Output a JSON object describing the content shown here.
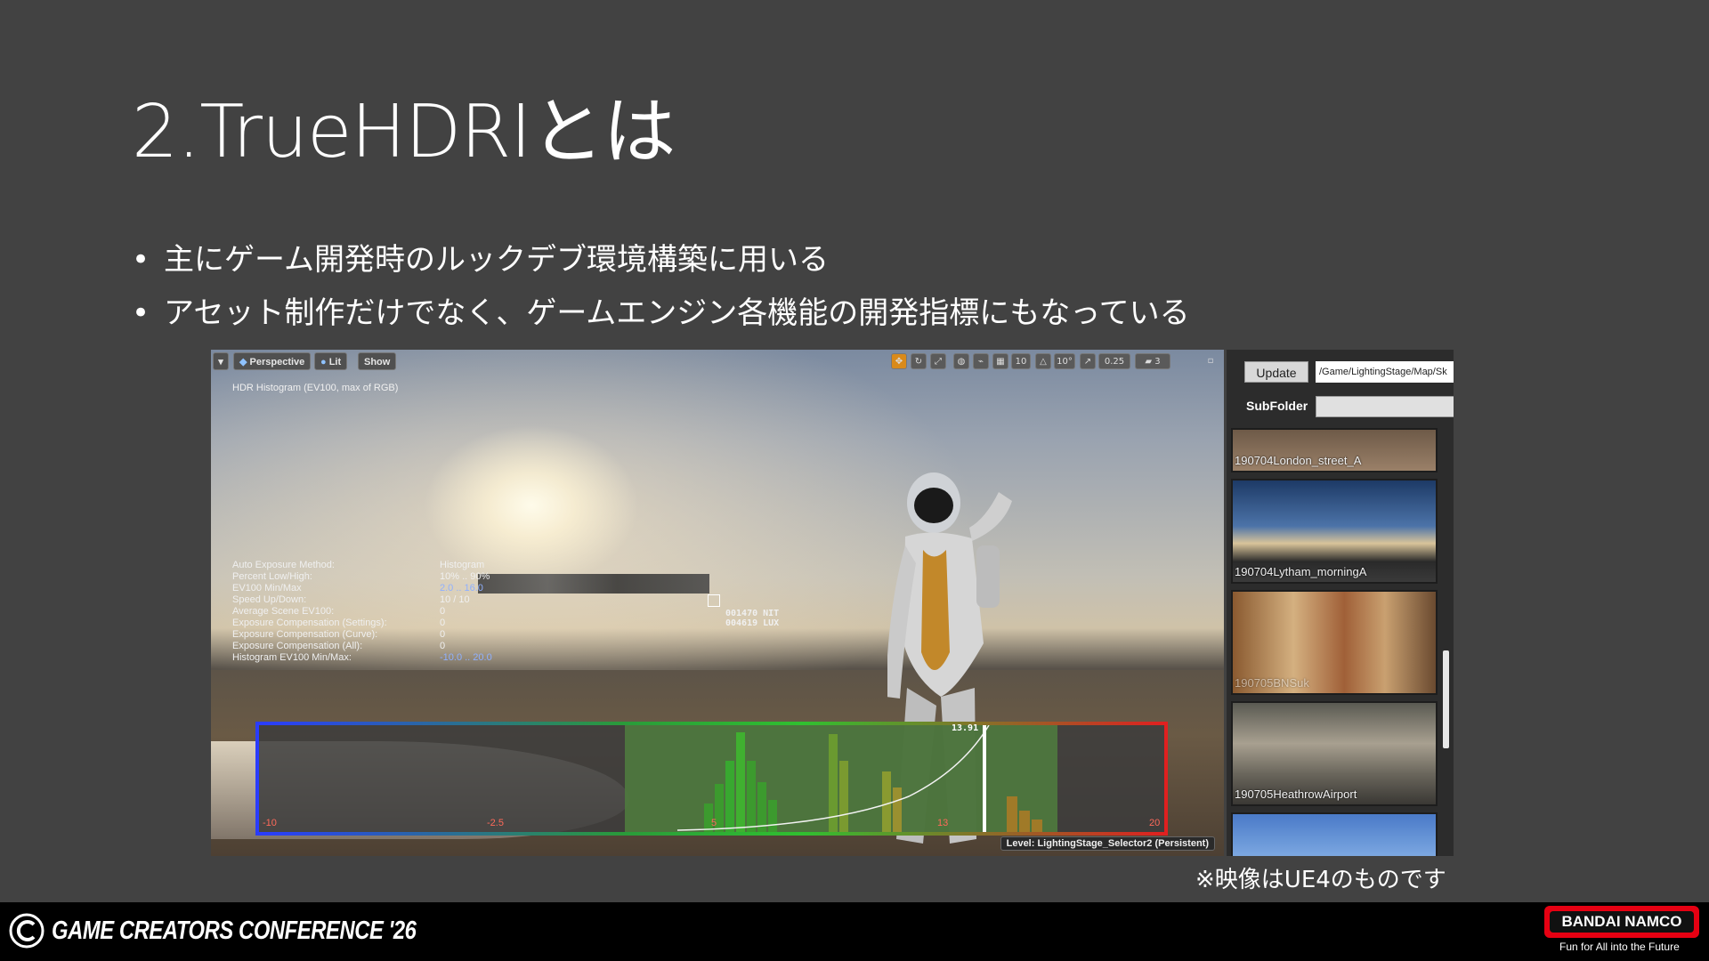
{
  "slide": {
    "title": "2.TrueHDRIとは",
    "bullets": [
      "主にゲーム開発時のルックデブ環境構築に用いる",
      "アセット制作だけでなく、ゲームエンジン各機能の開発指標にもなっている"
    ],
    "note": "※映像はUE4のものです"
  },
  "viewport": {
    "toolbar": {
      "dropdown": "▾",
      "perspective": "Perspective",
      "lit": "Lit",
      "show": "Show",
      "grid_snap": "10",
      "angle_snap": "10°",
      "scale_snap": "0.25",
      "camera_speed": "3"
    },
    "histogram_title": "HDR Histogram (EV100, max of RGB)",
    "stats": [
      {
        "label": "Auto Exposure Method:",
        "value": "Histogram",
        "color": "#f0f0f0"
      },
      {
        "label": "Percent Low/High:",
        "value": "10% .. 90%",
        "color": "#f0f0f0"
      },
      {
        "label": "EV100 Min/Max",
        "value": "2.0 .. 16.0",
        "color": "#8fb0ff"
      },
      {
        "label": "Speed Up/Down:",
        "value": "10 / 10",
        "color": "#f0f0f0"
      },
      {
        "label": "Average Scene EV100:",
        "value": "0",
        "color": "#f0f0f0"
      },
      {
        "label": "Exposure Compensation (Settings):",
        "value": "0",
        "color": "#f0f0f0"
      },
      {
        "label": "Exposure Compensation (Curve):",
        "value": "0",
        "color": "#f0f0f0"
      },
      {
        "label": "Exposure Compensation (All):",
        "value": "0",
        "color": "#f0f0f0"
      },
      {
        "label": "Histogram EV100 Min/Max:",
        "value": "-10.0 .. 20.0",
        "color": "#8fb0ff"
      }
    ],
    "probe": {
      "nit": "001470 NIT",
      "lux": "004619 LUX"
    },
    "histogram": {
      "axis_labels": [
        "-10",
        "-2.5",
        "5",
        "13",
        "20"
      ],
      "current_value": "13.91"
    },
    "level_label": "Level:  LightingStage_Selector2 (Persistent)"
  },
  "side_panel": {
    "update_label": "Update",
    "path_value": "/Game/LightingStage/Map/Sk",
    "subfolder_label": "SubFolder",
    "items": [
      {
        "label": "190704London_street_A"
      },
      {
        "label": "190704Lytham_morningA"
      },
      {
        "label": "190705BNSuk"
      },
      {
        "label": "190705HeathrowAirport"
      },
      {
        "label": ""
      }
    ]
  },
  "footer": {
    "event_name": "GAME CREATORS CONFERENCE '26",
    "brand": "BANDAI NAMCO",
    "tagline": "Fun for All into the Future"
  },
  "colors": {
    "slide_bg": "#424242",
    "footer_bg": "#000000",
    "brand_red": "#e60012",
    "hist_blue": "#2a3cff",
    "hist_green": "#30c030",
    "hist_red": "#e02020"
  }
}
